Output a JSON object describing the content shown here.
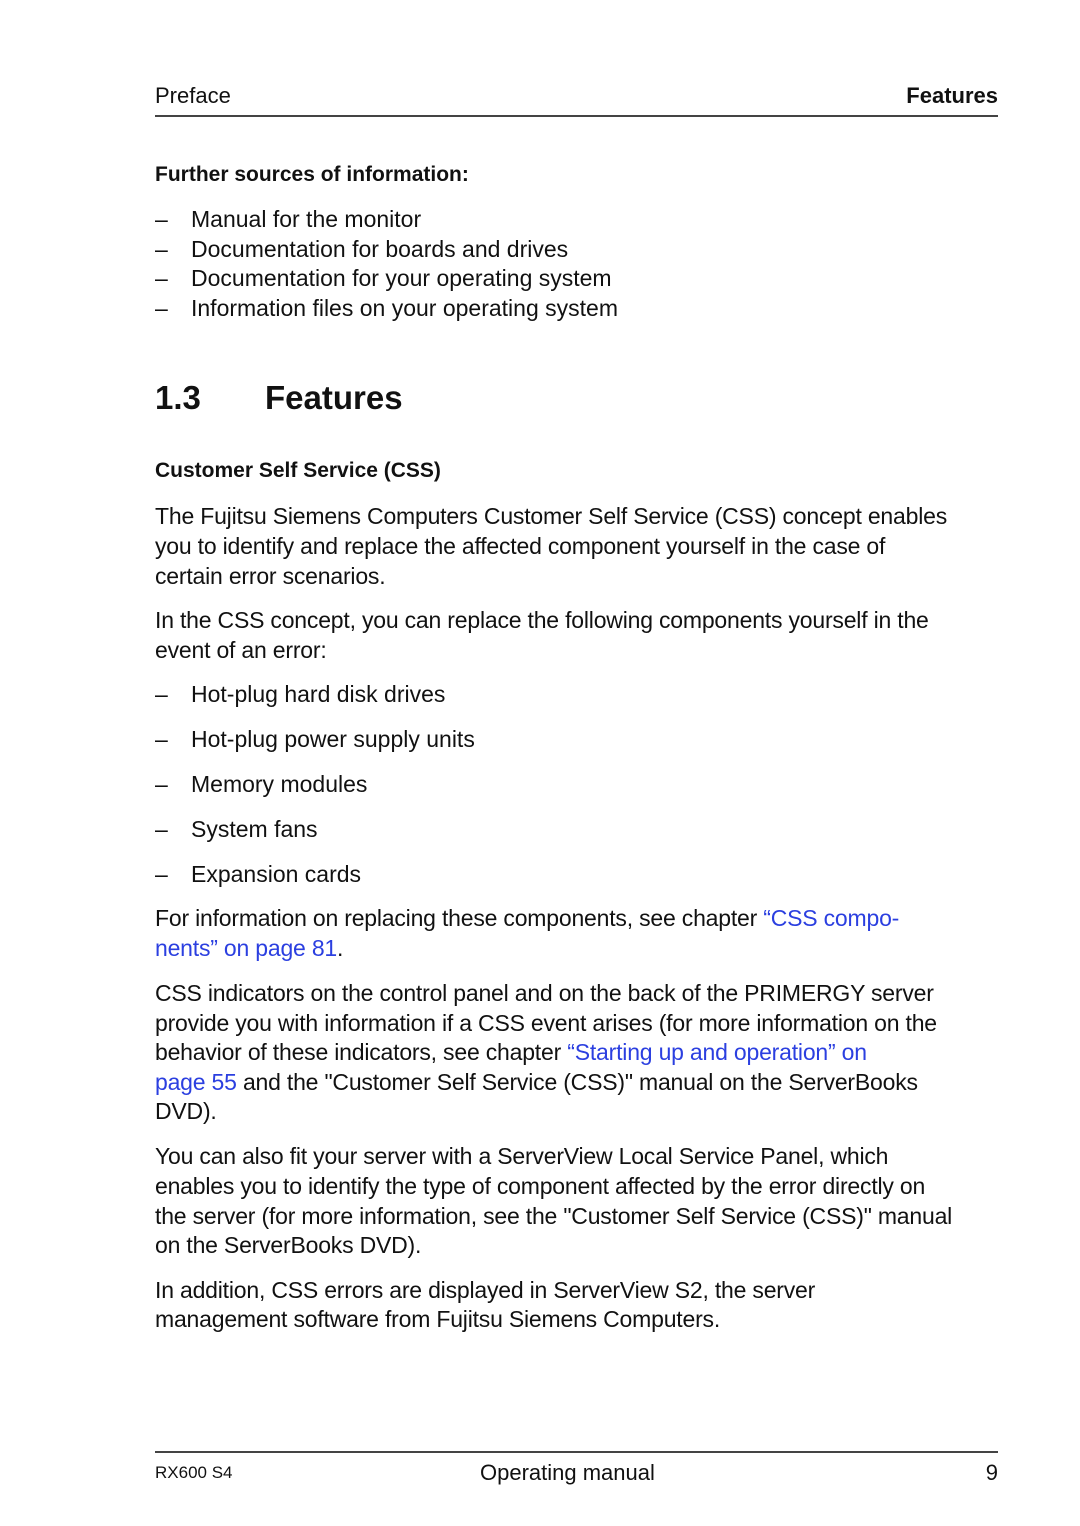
{
  "header": {
    "section": "Preface",
    "chapter": "Features"
  },
  "further_sources": {
    "heading": "Further sources of information:",
    "items": [
      "Manual for the monitor",
      "Documentation for boards and drives",
      "Documentation for your operating system",
      "Information files on your operating system"
    ]
  },
  "section": {
    "number": "1.3",
    "title": "Features"
  },
  "css": {
    "heading": "Customer Self Service (CSS)",
    "p1_lines": [
      "The Fujitsu Siemens Computers Customer Self Service (CSS) concept enables",
      "you to identify and replace the affected component yourself in the case of",
      "certain error scenarios."
    ],
    "p2_lines": [
      "In the CSS concept, you can replace the following components yourself in the",
      "event of an error:"
    ],
    "components": [
      "Hot-plug hard disk drives",
      "Hot-plug power supply units",
      "Memory modules",
      "System fans",
      "Expansion cards"
    ],
    "p3": {
      "prefix": "For information on replacing these components, see chapter ",
      "link_line1": "“CSS compo-",
      "link_line2": "nents” on page 81",
      "suffix": "."
    },
    "p4": {
      "line1": "CSS indicators on the control panel and on the back of the PRIMERGY server",
      "line2": "provide you with information if a CSS event arises (for more information on the",
      "line3_prefix": "behavior of these indicators, see chapter ",
      "link_line1": "“Starting up and operation” on",
      "link_line2": "page 55",
      "line4_suffix": " and the \"Customer Self Service (CSS)\" manual on the ServerBooks",
      "line5": "DVD)."
    },
    "p5_lines": [
      "You can also fit your server with a ServerView Local Service Panel, which",
      "enables you to identify the type of component affected by the error directly on",
      "the server (for more information, see the \"Customer Self Service (CSS)\" manual",
      "on the ServerBooks DVD)."
    ],
    "p6_lines": [
      "In addition, CSS errors are displayed in ServerView S2, the server",
      "management software from Fujitsu Siemens Computers."
    ]
  },
  "footer": {
    "model": "RX600 S4",
    "doc_type": "Operating manual",
    "page": "9"
  },
  "colors": {
    "link": "#2b3fe0",
    "text": "#111111"
  }
}
